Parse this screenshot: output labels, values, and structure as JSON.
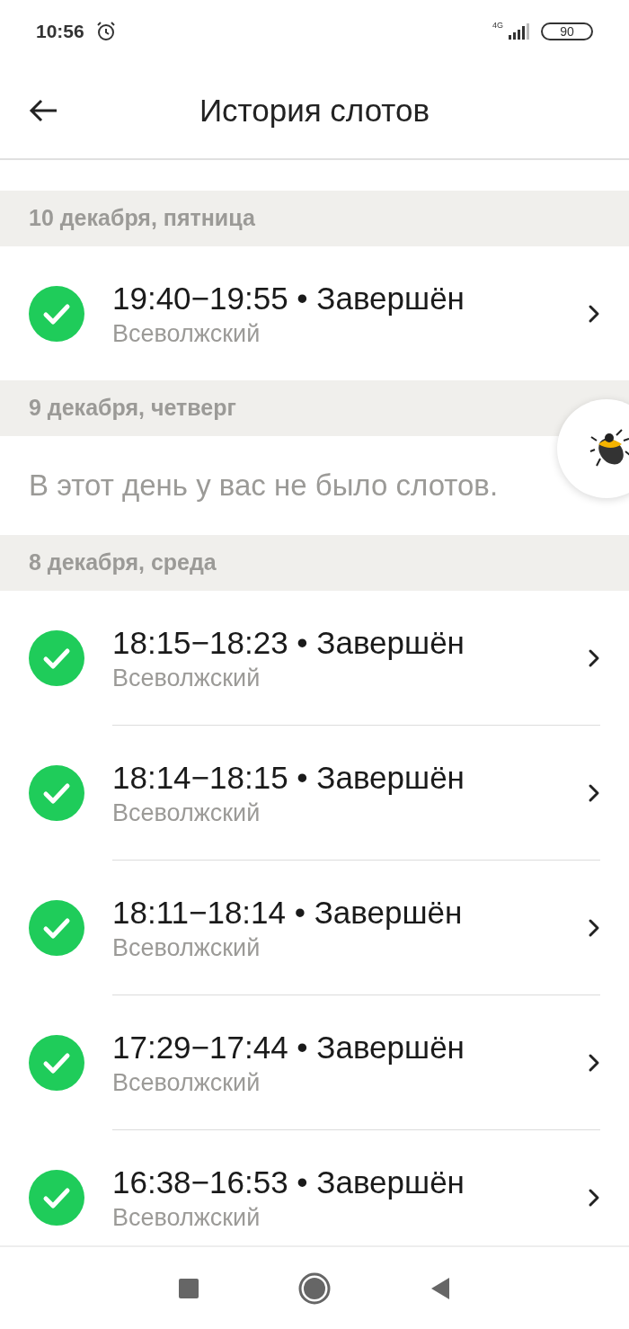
{
  "status_bar": {
    "time": "10:56",
    "network": "4G",
    "battery": "90"
  },
  "header": {
    "title": "История слотов"
  },
  "days": [
    {
      "date": "10 декабря, пятница",
      "slots": [
        {
          "title": "19:40−19:55 • Завершён",
          "place": "Всеволжский"
        }
      ]
    },
    {
      "date": "9 декабря, четверг",
      "empty_text": "В этот день у вас не было слотов."
    },
    {
      "date": "8 декабря, среда",
      "slots": [
        {
          "title": "18:15−18:23 • Завершён",
          "place": "Всеволжский"
        },
        {
          "title": "18:14−18:15 • Завершён",
          "place": "Всеволжский"
        },
        {
          "title": "18:11−18:14 • Завершён",
          "place": "Всеволжский"
        },
        {
          "title": "17:29−17:44 • Завершён",
          "place": "Всеволжский"
        },
        {
          "title": "16:38−16:53 • Завершён",
          "place": "Всеволжский"
        }
      ]
    }
  ]
}
